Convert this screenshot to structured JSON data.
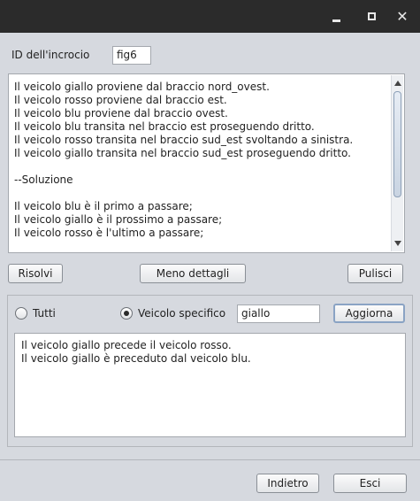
{
  "window": {
    "close_glyph": "✕"
  },
  "header": {
    "id_label": "ID dell'incrocio",
    "id_value": "fig6"
  },
  "output": {
    "lines": [
      "Il veicolo giallo proviene dal braccio nord_ovest.",
      "Il veicolo rosso proviene dal braccio est.",
      "Il veicolo blu proviene dal braccio ovest.",
      "Il veicolo blu transita nel braccio est proseguendo dritto.",
      "Il veicolo rosso transita nel braccio sud_est svoltando a sinistra.",
      "Il veicolo giallo transita nel braccio sud_est proseguendo dritto.",
      "",
      "--Soluzione",
      "",
      "Il veicolo blu è il primo a passare;",
      "Il veicolo giallo è il prossimo a passare;",
      "Il veicolo rosso è l'ultimo a passare;"
    ]
  },
  "actions": {
    "solve": "Risolvi",
    "less_details": "Meno dettagli",
    "clear": "Pulisci"
  },
  "filter": {
    "all_label": "Tutti",
    "all_checked": false,
    "specific_label": "Veicolo specifico",
    "specific_checked": true,
    "vehicle_value": "giallo",
    "update": "Aggiorna"
  },
  "result": {
    "lines": [
      "Il veicolo giallo precede il veicolo rosso.",
      "Il veicolo giallo è preceduto dal veicolo blu."
    ]
  },
  "footer": {
    "back": "Indietro",
    "exit": "Esci"
  }
}
